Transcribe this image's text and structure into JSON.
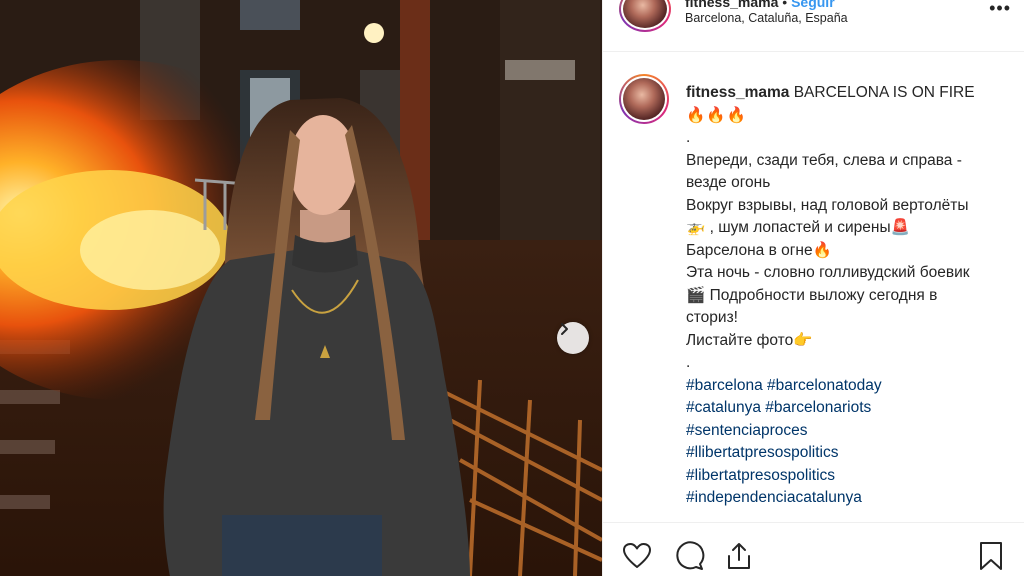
{
  "header": {
    "username": "fitness_mama",
    "separator": "•",
    "follow_label": "Seguir",
    "location": "Barcelona, Cataluña, España",
    "more_label": "•••"
  },
  "caption": {
    "username": "fitness_mama",
    "title": "BARCELONA IS ON FIRE",
    "title_emoji": "🔥🔥🔥",
    "dot1": ".",
    "lines": [
      "Впереди, сзади тебя, слева и справа - везде огонь",
      "Вокруг взрывы, над головой вертолёты🚁 , шум лопастей и сирены🚨 Барселона в огне🔥",
      "Эта ночь - словно голливудский боевик🎬 Подробности выложу сегодня в сториз!",
      "Листайте фото👉"
    ],
    "dot2": ".",
    "hashtags": [
      "#barcelona #barcelonatoday",
      "#catalunya #barcelonariots",
      "#sentenciaproces",
      "#llibertatpresospolitics",
      "#libertatpresospolitics",
      "#independenciacatalunya"
    ]
  },
  "actions": {
    "like_icon": "heart-icon",
    "comment_icon": "comment-icon",
    "share_icon": "share-icon",
    "save_icon": "bookmark-icon"
  },
  "photo": {
    "description_icon": "chevron-right-icon"
  },
  "colors": {
    "link": "#003569",
    "follow": "#3897f0",
    "text": "#262626",
    "border": "#efefef"
  }
}
